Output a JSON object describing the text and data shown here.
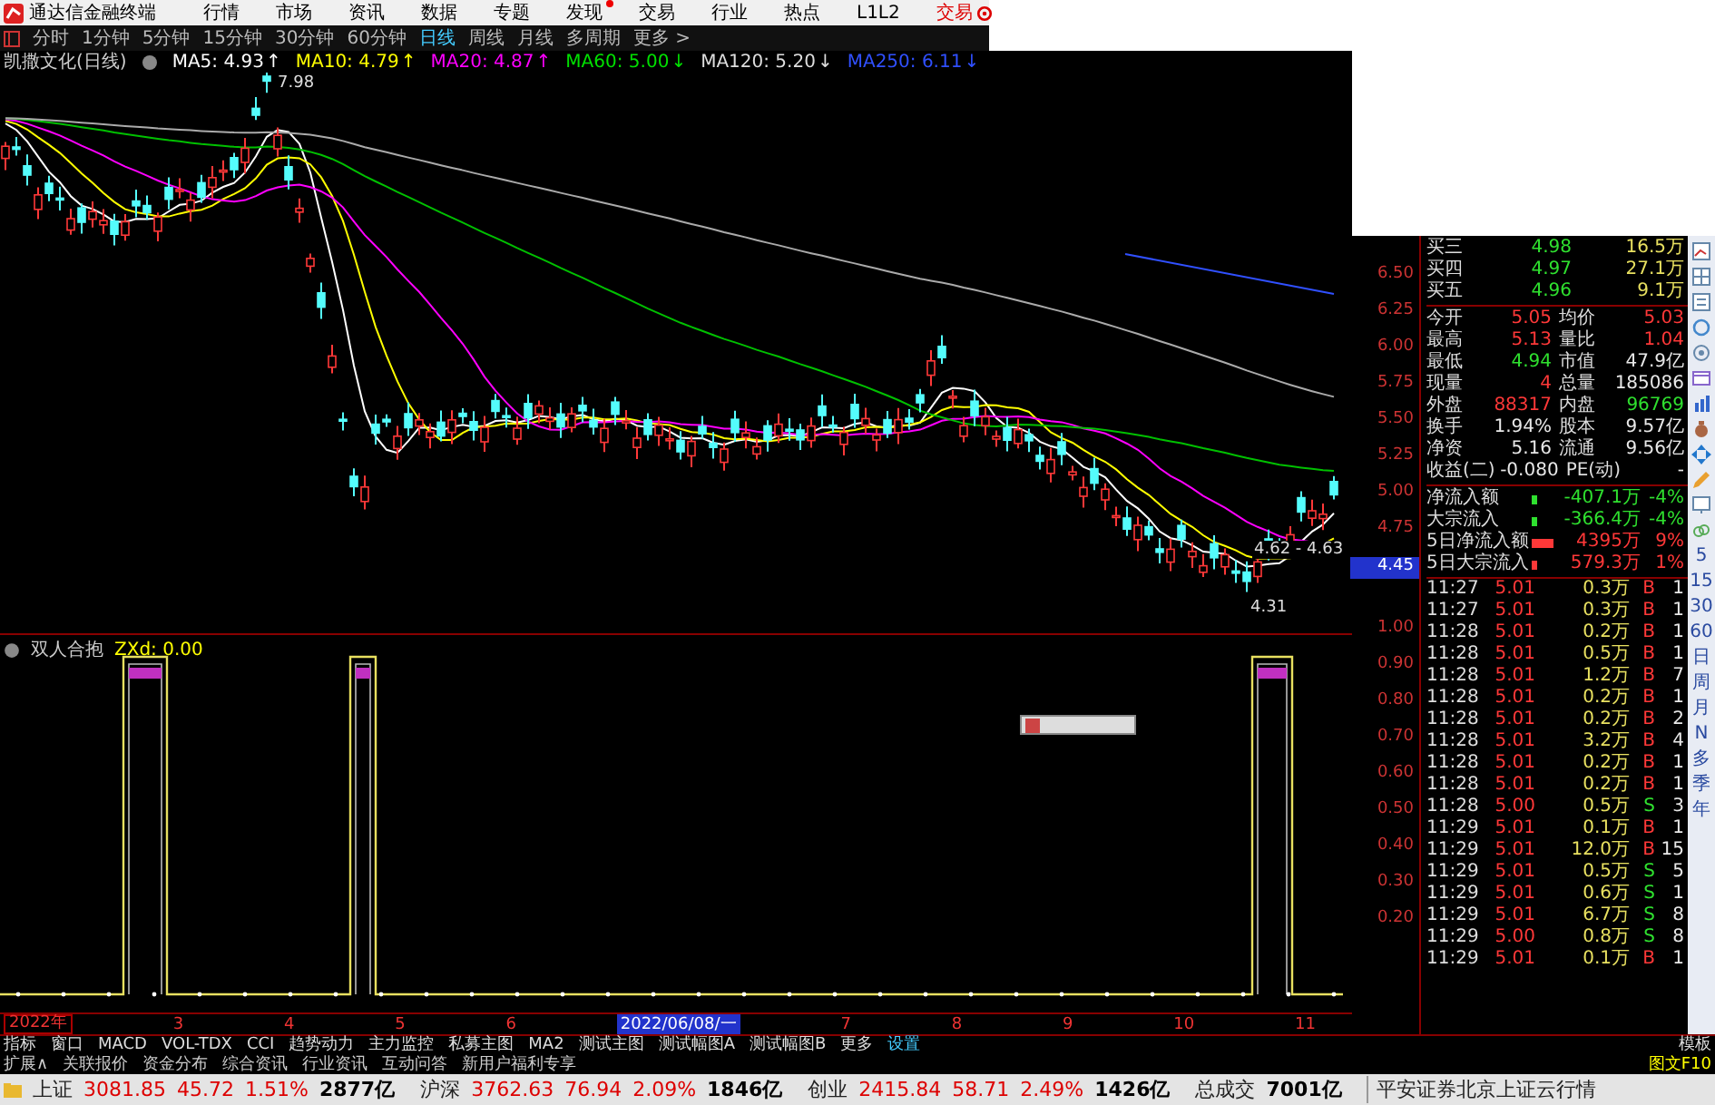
{
  "menu_bar": {
    "app_title": "通达信金融终端",
    "items": [
      {
        "label": "行情",
        "dot": false
      },
      {
        "label": "市场",
        "dot": false
      },
      {
        "label": "资讯",
        "dot": false
      },
      {
        "label": "数据",
        "dot": false
      },
      {
        "label": "专题",
        "dot": false
      },
      {
        "label": "发现",
        "dot": true
      },
      {
        "label": "交易",
        "dot": false
      },
      {
        "label": "行业",
        "dot": false
      },
      {
        "label": "热点",
        "dot": false
      },
      {
        "label": "L1L2",
        "dot": false
      }
    ],
    "trade_button": "交易"
  },
  "period_bar": {
    "items": [
      {
        "label": "分时",
        "selected": false
      },
      {
        "label": "1分钟",
        "selected": false
      },
      {
        "label": "5分钟",
        "selected": false
      },
      {
        "label": "15分钟",
        "selected": false
      },
      {
        "label": "30分钟",
        "selected": false
      },
      {
        "label": "60分钟",
        "selected": false
      },
      {
        "label": "日线",
        "selected": true
      },
      {
        "label": "周线",
        "selected": false
      },
      {
        "label": "月线",
        "selected": false
      },
      {
        "label": "多周期",
        "selected": false
      },
      {
        "label": "更多 >",
        "selected": false
      }
    ]
  },
  "ma_legend": {
    "stock": "凯撒文化(日线)",
    "items": [
      {
        "label": "MA5: 4.93",
        "arrow": "↑",
        "color": "#ffffff"
      },
      {
        "label": "MA10: 4.79",
        "arrow": "↑",
        "color": "#ffff00"
      },
      {
        "label": "MA20: 4.87",
        "arrow": "↑",
        "color": "#ff00ff"
      },
      {
        "label": "MA60: 5.00",
        "arrow": "↓",
        "color": "#00e000"
      },
      {
        "label": "MA120: 5.20",
        "arrow": "↓",
        "color": "#dddddd"
      },
      {
        "label": "MA250: 6.11",
        "arrow": "↓",
        "color": "#3050ff"
      }
    ]
  },
  "main_chart": {
    "high_label": "7.98",
    "low_label": "4.31",
    "range_label": "4.62 - 4.63",
    "price_axis": [
      "6.50",
      "6.25",
      "6.00",
      "5.75",
      "5.50",
      "5.25",
      "5.00",
      "4.75"
    ],
    "cursor_price": "4.45"
  },
  "indicator": {
    "name": "双人合抱",
    "value": "ZXd: 0.00",
    "axis": [
      "1.00",
      "0.90",
      "0.80",
      "0.70",
      "0.60",
      "0.50",
      "0.40",
      "0.30",
      "0.20"
    ]
  },
  "date_axis": {
    "year": "2022年",
    "labels": [
      {
        "text": "3",
        "kind": "month"
      },
      {
        "text": "4",
        "kind": "month"
      },
      {
        "text": "5",
        "kind": "month"
      },
      {
        "text": "6",
        "kind": "month"
      },
      {
        "text": "2022/06/08/一",
        "kind": "cursor"
      },
      {
        "text": "7",
        "kind": "month"
      },
      {
        "text": "8",
        "kind": "month"
      },
      {
        "text": "9",
        "kind": "month"
      },
      {
        "text": "10",
        "kind": "month"
      },
      {
        "text": "11",
        "kind": "month"
      }
    ]
  },
  "quote_panel": {
    "order_book": [
      {
        "label": "买三",
        "price": "4.98",
        "volume": "16.5万",
        "color": "#2fe02f"
      },
      {
        "label": "买四",
        "price": "4.97",
        "volume": "27.1万",
        "color": "#2fe02f"
      },
      {
        "label": "买五",
        "price": "4.96",
        "volume": "9.1万",
        "color": "#2fe02f"
      }
    ],
    "stats": [
      [
        {
          "label": "今开",
          "value": "5.05",
          "color": "#ff3838"
        },
        {
          "label": "均价",
          "value": "5.03",
          "color": "#ff3838"
        }
      ],
      [
        {
          "label": "最高",
          "value": "5.13",
          "color": "#ff3838"
        },
        {
          "label": "量比",
          "value": "1.04",
          "color": "#ff3838"
        }
      ],
      [
        {
          "label": "最低",
          "value": "4.94",
          "color": "#2fe02f"
        },
        {
          "label": "市值",
          "value": "47.9亿",
          "color": "#e8e8e8"
        }
      ],
      [
        {
          "label": "现量",
          "value": "4",
          "color": "#ff3838"
        },
        {
          "label": "总量",
          "value": "185086",
          "color": "#e8e8e8"
        }
      ],
      [
        {
          "label": "外盘",
          "value": "88317",
          "color": "#ff3838"
        },
        {
          "label": "内盘",
          "value": "96769",
          "color": "#2fe02f"
        }
      ],
      [
        {
          "label": "换手",
          "value": "1.94%",
          "color": "#e8e8e8"
        },
        {
          "label": "股本",
          "value": "9.57亿",
          "color": "#e8e8e8"
        }
      ],
      [
        {
          "label": "净资",
          "value": "5.16",
          "color": "#e8e8e8"
        },
        {
          "label": "流通",
          "value": "9.56亿",
          "color": "#e8e8e8"
        }
      ],
      [
        {
          "label": "收益(二)",
          "value": "-0.080",
          "color": "#e8e8e8"
        },
        {
          "label": "PE(动)",
          "value": "-",
          "color": "#e8e8e8"
        }
      ]
    ],
    "flows": [
      {
        "label": "净流入额",
        "value": "-407.1万",
        "pct": "-4%",
        "color": "#2fe02f"
      },
      {
        "label": "大宗流入",
        "value": "-366.4万",
        "pct": "-4%",
        "color": "#2fe02f"
      },
      {
        "label": "5日净流入额",
        "value": "4395万",
        "pct": "9%",
        "color": "#ff3838"
      },
      {
        "label": "5日大宗流入",
        "value": "579.3万",
        "pct": "1%",
        "color": "#ff3838"
      }
    ],
    "ticks": [
      {
        "time": "11:27",
        "price": "5.01",
        "volume": "0.3万",
        "side": "B",
        "color": "#ff3838",
        "count": "1"
      },
      {
        "time": "11:27",
        "price": "5.01",
        "volume": "0.3万",
        "side": "B",
        "color": "#ff3838",
        "count": "1"
      },
      {
        "time": "11:28",
        "price": "5.01",
        "volume": "0.2万",
        "side": "B",
        "color": "#ff3838",
        "count": "1"
      },
      {
        "time": "11:28",
        "price": "5.01",
        "volume": "0.5万",
        "side": "B",
        "color": "#ff3838",
        "count": "1"
      },
      {
        "time": "11:28",
        "price": "5.01",
        "volume": "1.2万",
        "side": "B",
        "color": "#ff3838",
        "count": "7"
      },
      {
        "time": "11:28",
        "price": "5.01",
        "volume": "0.2万",
        "side": "B",
        "color": "#ff3838",
        "count": "1"
      },
      {
        "time": "11:28",
        "price": "5.01",
        "volume": "0.2万",
        "side": "B",
        "color": "#ff3838",
        "count": "2"
      },
      {
        "time": "11:28",
        "price": "5.01",
        "volume": "3.2万",
        "side": "B",
        "color": "#ff3838",
        "count": "4"
      },
      {
        "time": "11:28",
        "price": "5.01",
        "volume": "0.2万",
        "side": "B",
        "color": "#ff3838",
        "count": "1"
      },
      {
        "time": "11:28",
        "price": "5.01",
        "volume": "0.2万",
        "side": "B",
        "color": "#ff3838",
        "count": "1"
      },
      {
        "time": "11:28",
        "price": "5.00",
        "volume": "0.5万",
        "side": "S",
        "color": "#2fe02f",
        "count": "3"
      },
      {
        "time": "11:29",
        "price": "5.01",
        "volume": "0.1万",
        "side": "B",
        "color": "#ff3838",
        "count": "1"
      },
      {
        "time": "11:29",
        "price": "5.01",
        "volume": "12.0万",
        "side": "B",
        "color": "#ff3838",
        "count": "15"
      },
      {
        "time": "11:29",
        "price": "5.01",
        "volume": "0.5万",
        "side": "S",
        "color": "#2fe02f",
        "count": "5"
      },
      {
        "time": "11:29",
        "price": "5.01",
        "volume": "0.6万",
        "side": "S",
        "color": "#2fe02f",
        "count": "1"
      },
      {
        "time": "11:29",
        "price": "5.01",
        "volume": "6.7万",
        "side": "S",
        "color": "#2fe02f",
        "count": "8"
      },
      {
        "time": "11:29",
        "price": "5.00",
        "volume": "0.8万",
        "side": "S",
        "color": "#2fe02f",
        "count": "8"
      },
      {
        "time": "11:29",
        "price": "5.01",
        "volume": "0.1万",
        "side": "B",
        "color": "#ff3838",
        "count": "1"
      }
    ]
  },
  "toolbar": {
    "periods": [
      "5",
      "15",
      "30",
      "60",
      "日",
      "周",
      "月",
      "N",
      "多",
      "季",
      "年"
    ]
  },
  "indicator_tabs": {
    "items": [
      "指标",
      "窗口",
      "MACD",
      "VOL-TDX",
      "CCI",
      "趋势动力",
      "主力监控",
      "私募主图",
      "MA2",
      "测试主图",
      "测试幅图A",
      "测试幅图B",
      "更多"
    ],
    "settings": "设置",
    "template": "模板"
  },
  "extension_bar": {
    "toggle": "扩展∧",
    "items": [
      "关联报价",
      "资金分布",
      "综合资讯",
      "行业资讯",
      "互动问答",
      "新用户福利专享"
    ],
    "f10": "图文F10"
  },
  "status_bar": {
    "indices": [
      {
        "name": "上证",
        "value": "3081.85",
        "change": "45.72",
        "pct": "1.51%",
        "amount": "2877亿",
        "color": "#dd0000"
      },
      {
        "name": "沪深",
        "value": "3762.63",
        "change": "76.94",
        "pct": "2.09%",
        "amount": "1846亿",
        "color": "#dd0000"
      },
      {
        "name": "创业",
        "value": "2415.84",
        "change": "58.71",
        "pct": "2.49%",
        "amount": "1426亿",
        "color": "#dd0000"
      }
    ],
    "total": {
      "label": "总成交",
      "value": "7001亿"
    },
    "source": "平安证券北京上证云行情"
  }
}
